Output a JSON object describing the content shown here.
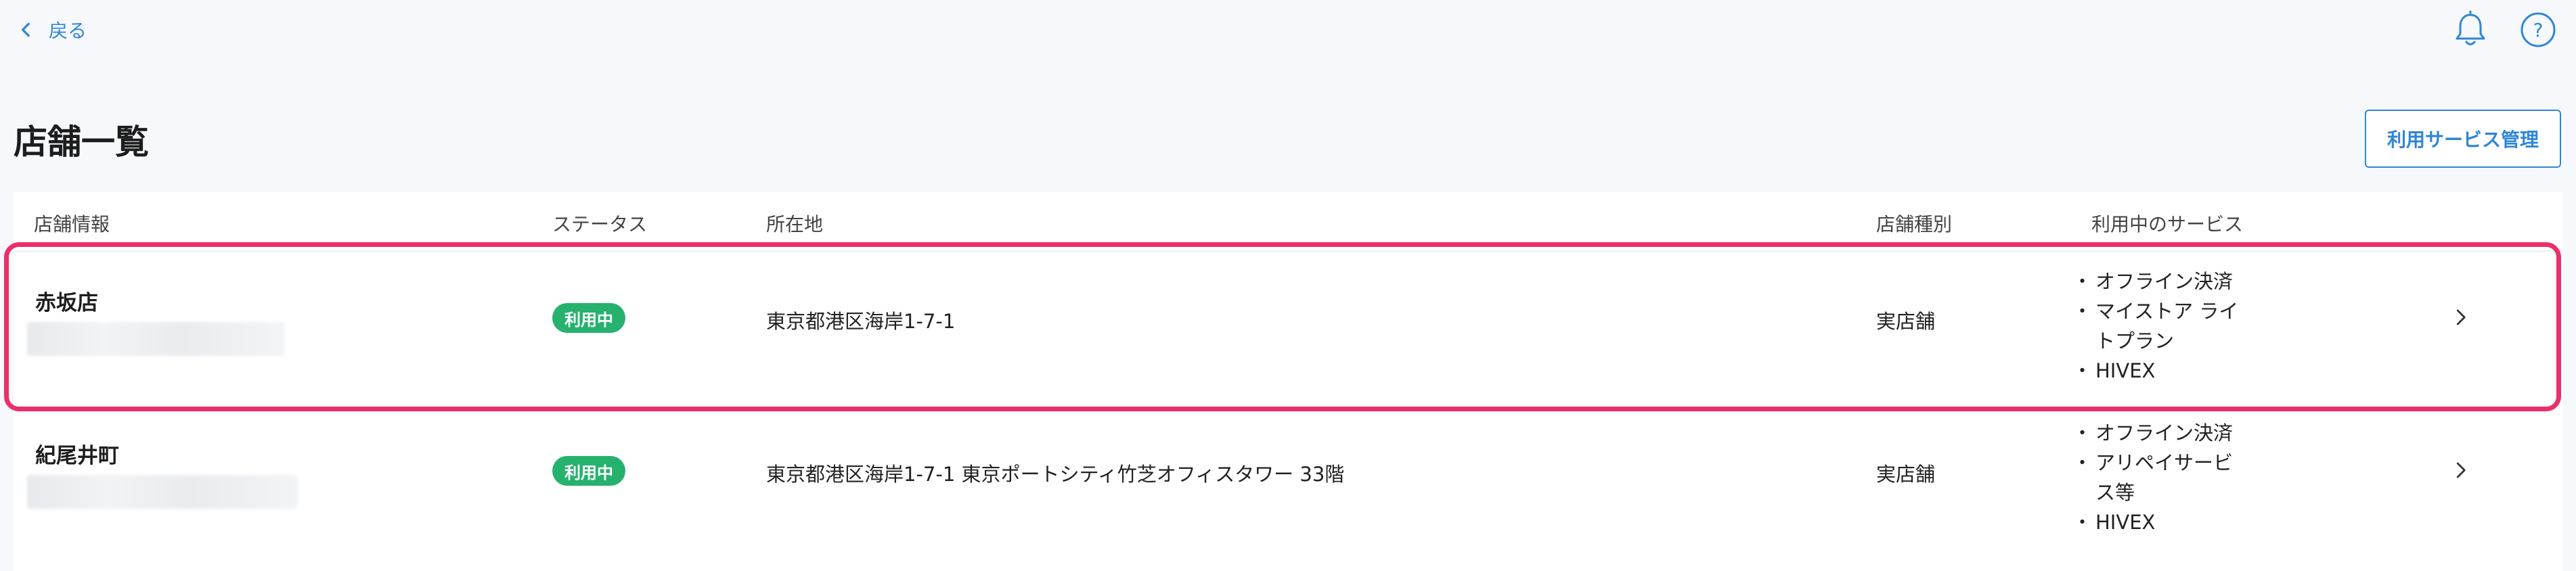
{
  "topbar": {
    "back_label": "戻る",
    "bell_icon": "bell-icon",
    "help_icon": "help-icon"
  },
  "page": {
    "title": "店舗一覧",
    "service_button": "利用サービス管理"
  },
  "table": {
    "headers": [
      "店舗情報",
      "ステータス",
      "所在地",
      "店舗種別",
      "利用中のサービス"
    ],
    "rows": [
      {
        "name": "赤坂店",
        "status": "利用中",
        "address": "東京都港区海岸1-7-1",
        "type": "実店舗",
        "services": [
          "オフライン決済",
          "マイストア ライ",
          "トプラン",
          "HIVEX"
        ]
      },
      {
        "name": "紀尾井町",
        "status": "利用中",
        "address": "東京都港区海岸1-7-1 東京ポートシティ竹芝オフィスタワー 33階",
        "type": "実店舗",
        "services": [
          "オフライン決済",
          "アリペイサービ",
          "ス等",
          "HIVEX"
        ]
      }
    ]
  },
  "colors": {
    "accent": "#2f86d6",
    "status_green": "#26b26e",
    "highlight": "#ec2f6a"
  }
}
